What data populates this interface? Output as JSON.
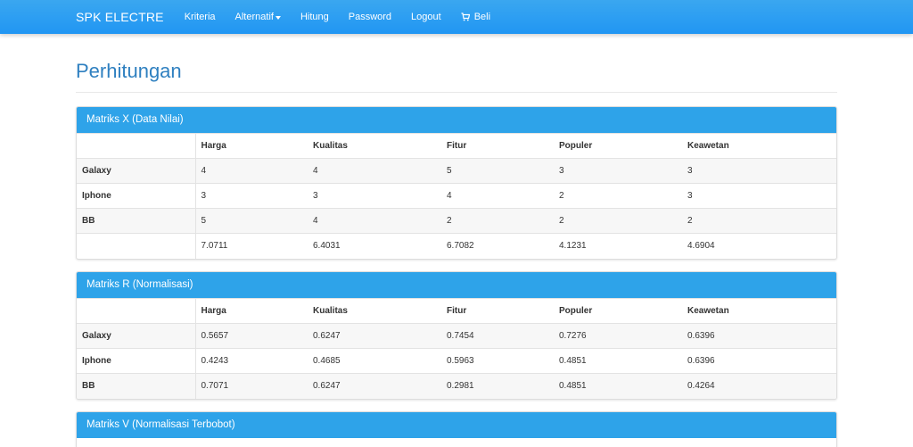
{
  "navbar": {
    "brand": "SPK ELECTRE",
    "items": [
      "Kriteria",
      "Alternatif",
      "Hitung",
      "Password",
      "Logout",
      "Beli"
    ]
  },
  "page": {
    "title": "Perhitungan"
  },
  "columns": [
    "",
    "Harga",
    "Kualitas",
    "Fitur",
    "Populer",
    "Keawetan"
  ],
  "panels": [
    {
      "title": "Matriks X (Data Nilai)",
      "rows": [
        [
          "Galaxy",
          "4",
          "4",
          "5",
          "3",
          "3"
        ],
        [
          "Iphone",
          "3",
          "3",
          "4",
          "2",
          "3"
        ],
        [
          "BB",
          "5",
          "4",
          "2",
          "2",
          "2"
        ],
        [
          "",
          "7.0711",
          "6.4031",
          "6.7082",
          "4.1231",
          "4.6904"
        ]
      ]
    },
    {
      "title": "Matriks R (Normalisasi)",
      "rows": [
        [
          "Galaxy",
          "0.5657",
          "0.6247",
          "0.7454",
          "0.7276",
          "0.6396"
        ],
        [
          "Iphone",
          "0.4243",
          "0.4685",
          "0.5963",
          "0.4851",
          "0.6396"
        ],
        [
          "BB",
          "0.7071",
          "0.6247",
          "0.2981",
          "0.4851",
          "0.4264"
        ]
      ]
    },
    {
      "title": "Matriks V (Normalisasi Terbobot)",
      "rows": []
    }
  ],
  "colors": {
    "navbar": "#2196f3",
    "panel_heading": "#2ea3e9",
    "title": "#2f80c0"
  }
}
